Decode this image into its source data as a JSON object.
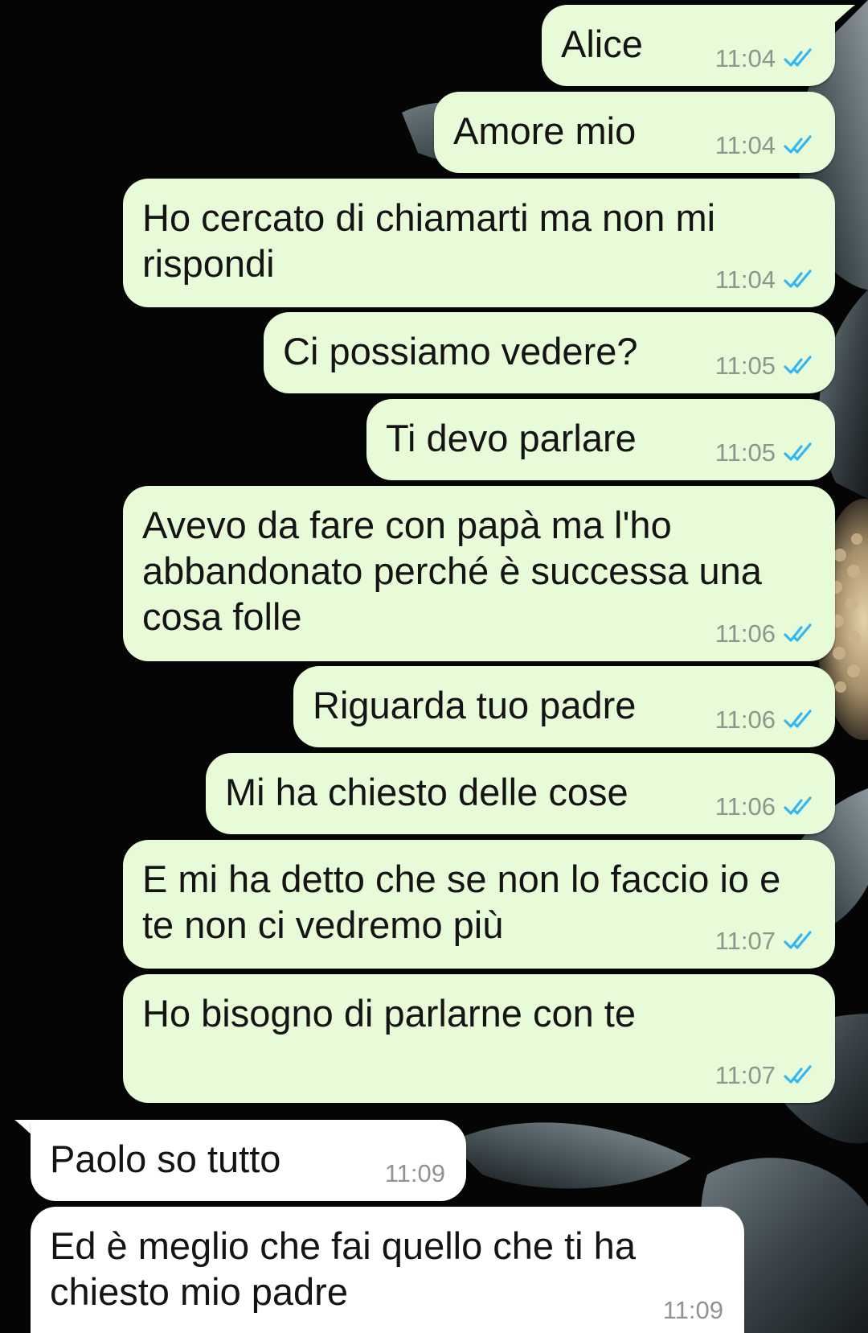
{
  "chat": {
    "messages": [
      {
        "direction": "out",
        "text": "Alice",
        "time": "11:04",
        "status_icon": "double-check-read-icon"
      },
      {
        "direction": "out",
        "text": "Amore mio",
        "time": "11:04",
        "status_icon": "double-check-read-icon"
      },
      {
        "direction": "out",
        "text": "Ho cercato di chiamarti ma non mi\nrispondi",
        "time": "11:04",
        "status_icon": "double-check-read-icon"
      },
      {
        "direction": "out",
        "text": "Ci possiamo vedere?",
        "time": "11:05",
        "status_icon": "double-check-read-icon"
      },
      {
        "direction": "out",
        "text": "Ti devo parlare",
        "time": "11:05",
        "status_icon": "double-check-read-icon"
      },
      {
        "direction": "out",
        "text": "Avevo da fare con papà ma l'ho\nabbandonato perché è successa una\ncosa folle",
        "time": "11:06",
        "status_icon": "double-check-read-icon"
      },
      {
        "direction": "out",
        "text": "Riguarda tuo padre",
        "time": "11:06",
        "status_icon": "double-check-read-icon"
      },
      {
        "direction": "out",
        "text": "Mi ha chiesto delle cose",
        "time": "11:06",
        "status_icon": "double-check-read-icon"
      },
      {
        "direction": "out",
        "text": "E mi ha detto che se non lo faccio io e\nte non ci vedremo più",
        "time": "11:07",
        "status_icon": "double-check-read-icon"
      },
      {
        "direction": "out",
        "text": "Ho bisogno di parlarne con te",
        "time": "11:07",
        "status_icon": "double-check-read-icon"
      },
      {
        "direction": "in",
        "text": "Paolo so tutto",
        "time": "11:09"
      },
      {
        "direction": "in",
        "text": "Ed è meglio che fai quello che ti ha\nchiesto mio padre",
        "time": "11:09"
      }
    ]
  },
  "colors": {
    "outgoing_bubble": "#e7fbd8",
    "incoming_bubble": "#ffffff",
    "read_ticks": "#34b7f1",
    "timestamp": "#8e958c",
    "wallpaper": "#050505"
  }
}
